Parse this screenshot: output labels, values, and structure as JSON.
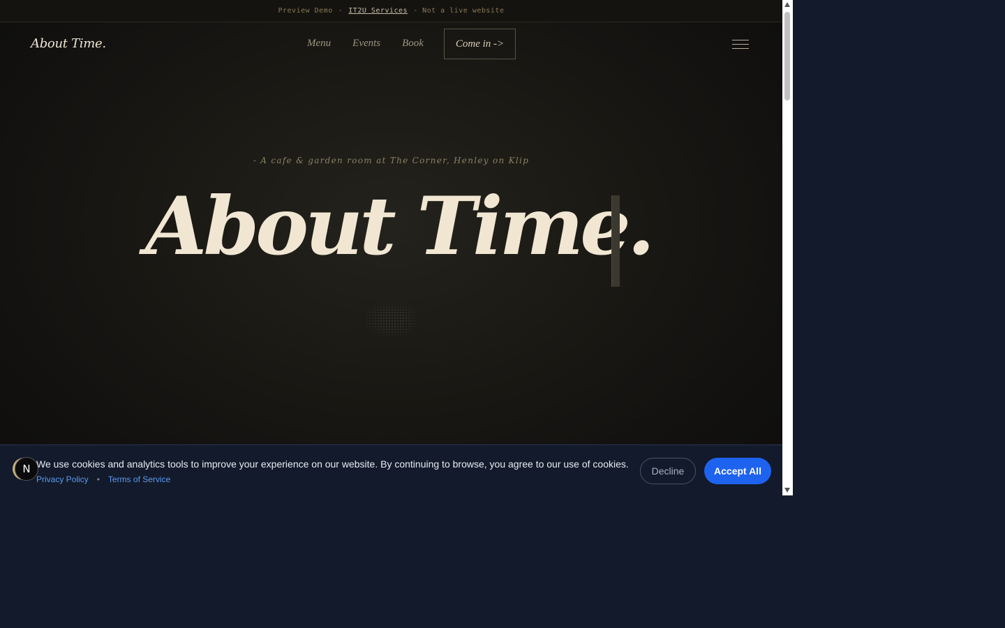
{
  "preview_bar": {
    "label": "Preview Demo",
    "separator": "-",
    "link_text": "IT2U Services",
    "suffix": "- Not a live website"
  },
  "header": {
    "brand": "About Time.",
    "nav": [
      {
        "label": "Menu"
      },
      {
        "label": "Events"
      },
      {
        "label": "Book"
      }
    ],
    "cta_label": "Come in ->",
    "menu_icon": "hamburger-icon"
  },
  "hero": {
    "tagline": "- A cafe & garden room at The Corner, Henley on Klip",
    "title": "About Time."
  },
  "cookie_banner": {
    "message": "We use cookies and analytics tools to improve your experience on our website. By continuing to browse, you agree to our use of cookies.",
    "privacy_link": "Privacy Policy",
    "link_separator": "•",
    "terms_link": "Terms of Service",
    "decline_label": "Decline",
    "accept_label": "Accept All"
  },
  "badge": {
    "letter": "N"
  },
  "colors": {
    "background": "#131a2b",
    "hero_text": "#f0e6d2",
    "accent_button": "#1e63f0",
    "link": "#5d9cf0",
    "preview_text": "#8b7a56"
  }
}
